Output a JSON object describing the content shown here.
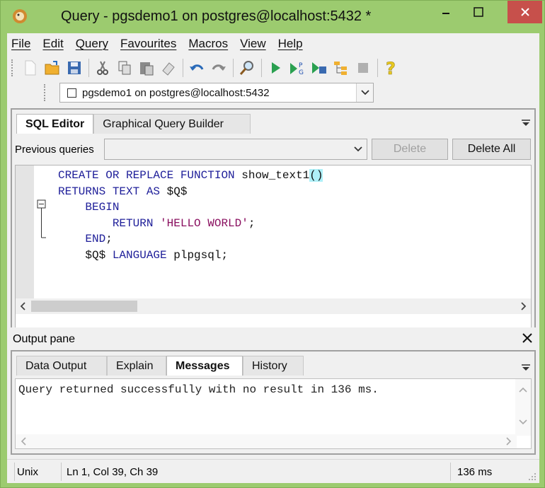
{
  "window": {
    "title": "Query - pgsdemo1 on postgres@localhost:5432 *",
    "close_color": "#c7504b"
  },
  "menu": [
    "File",
    "Edit",
    "Query",
    "Favourites",
    "Macros",
    "View",
    "Help"
  ],
  "toolbar_icons": [
    "new-file-icon",
    "open-folder-icon",
    "save-icon",
    "cut-icon",
    "copy-icon",
    "paste-icon",
    "clear-icon",
    "undo-icon",
    "redo-icon",
    "find-icon",
    "execute-icon",
    "execute-pgscript-icon",
    "execute-to-file-icon",
    "explain-icon",
    "cancel-query-icon",
    "help-icon"
  ],
  "connection": {
    "label": "pgsdemo1 on postgres@localhost:5432"
  },
  "editor": {
    "tabs": [
      "SQL Editor",
      "Graphical Query Builder"
    ],
    "active_tab": "SQL Editor",
    "previous_queries_label": "Previous queries",
    "previous_queries_value": "",
    "delete_label": "Delete",
    "delete_all_label": "Delete All",
    "code_lines": [
      "CREATE OR REPLACE FUNCTION show_text1()",
      "RETURNS TEXT AS $Q$",
      "  BEGIN",
      "    RETURN 'HELLO WORLD';",
      "  END;",
      "  $Q$ LANGUAGE plpgsql;"
    ]
  },
  "output": {
    "pane_title": "Output pane",
    "tabs": [
      "Data Output",
      "Explain",
      "Messages",
      "History"
    ],
    "active_tab": "Messages",
    "message": "Query returned successfully with no result in 136 ms."
  },
  "status": {
    "encoding": "Unix",
    "position": "Ln 1, Col 39, Ch 39",
    "time": "136 ms"
  }
}
